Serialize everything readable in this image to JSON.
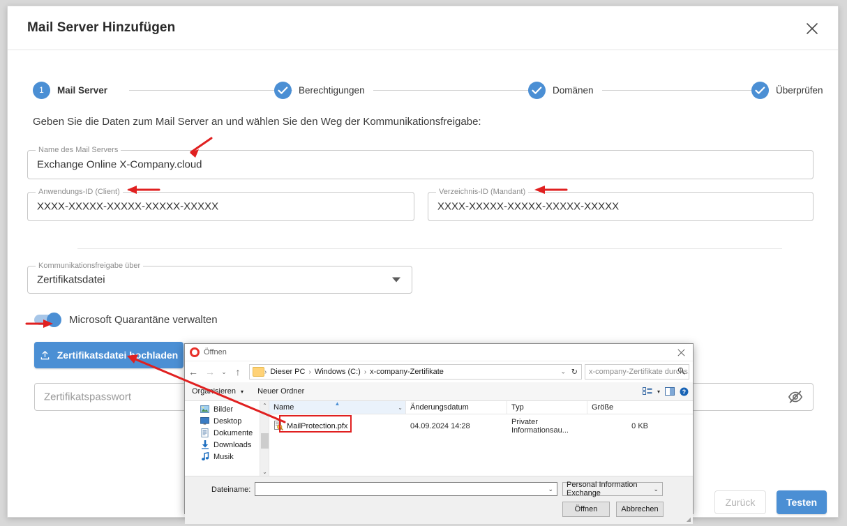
{
  "dialog": {
    "title": "Mail Server Hinzufügen",
    "close_icon": "close-icon"
  },
  "stepper": {
    "steps": [
      {
        "label": "Mail Server",
        "marker": "1",
        "state": "current"
      },
      {
        "label": "Berechtigungen",
        "marker": "check",
        "state": "done"
      },
      {
        "label": "Domänen",
        "marker": "check",
        "state": "done"
      },
      {
        "label": "Überprüfen",
        "marker": "check",
        "state": "done"
      }
    ]
  },
  "form": {
    "intro": "Geben Sie die Daten zum Mail Server an und wählen Sie den Weg der Kommunikationsfreigabe:",
    "server_name": {
      "legend": "Name des Mail Servers",
      "value": "Exchange Online X-Company.cloud"
    },
    "client_id": {
      "legend": "Anwendungs-ID (Client)",
      "value": "XXXX-XXXXX-XXXXX-XXXXX-XXXXX"
    },
    "tenant_id": {
      "legend": "Verzeichnis-ID (Mandant)",
      "value": "XXXX-XXXXX-XXXXX-XXXXX-XXXXX"
    },
    "share_mode": {
      "legend": "Kommunikationsfreigabe über",
      "value": "Zertifikatsdatei"
    },
    "quarantine_toggle": {
      "label": "Microsoft Quarantäne verwalten",
      "state": "on"
    },
    "upload_button": {
      "label": "Zertifikatsdatei hochladen",
      "icon": "upload-icon"
    },
    "cert_password": {
      "placeholder": "Zertifikatspasswort",
      "value": "",
      "toggle_icon": "eye-off-icon"
    }
  },
  "footer": {
    "back_label": "Zurück",
    "test_label": "Testen"
  },
  "file_dialog": {
    "title": "Öffnen",
    "logo_icon": "opera-logo-icon",
    "close_icon": "close-icon",
    "nav": {
      "back_icon": "arrow-left-icon",
      "forward_icon": "arrow-right-icon",
      "recent_icon": "chevron-down-icon",
      "up_icon": "arrow-up-icon"
    },
    "breadcrumb": {
      "folder_icon": "folder-icon",
      "segments": [
        "Dieser PC",
        "Windows (C:)",
        "x-company-Zertifikate"
      ],
      "separator": "›",
      "caret_icon": "chevron-down-icon",
      "refresh_icon": "refresh-icon"
    },
    "search": {
      "placeholder": "x-company-Zertifikate durchs...",
      "icon": "search-icon"
    },
    "toolbar": {
      "organize_label": "Organisieren",
      "organize_caret": "▾",
      "new_folder_label": "Neuer Ordner",
      "view_icon": "view-list-icon",
      "view_caret": "▾",
      "preview_icon": "preview-pane-icon",
      "help_icon": "help-icon"
    },
    "sidebar": [
      {
        "label": "Bilder",
        "icon": "pictures-icon"
      },
      {
        "label": "Desktop",
        "icon": "desktop-icon"
      },
      {
        "label": "Dokumente",
        "icon": "documents-icon"
      },
      {
        "label": "Downloads",
        "icon": "downloads-icon"
      },
      {
        "label": "Musik",
        "icon": "music-icon"
      }
    ],
    "columns": [
      "Name",
      "Änderungsdatum",
      "Typ",
      "Größe"
    ],
    "rows": [
      {
        "name": "MailProtection.pfx",
        "icon": "certificate-file-icon",
        "modified": "04.09.2024 14:28",
        "type": "Privater Informationsau...",
        "size": "0 KB"
      }
    ],
    "filename": {
      "label": "Dateiname:",
      "value": "",
      "caret_icon": "chevron-down-icon"
    },
    "filetype": {
      "value": "Personal Information Exchange",
      "caret_icon": "chevron-down-icon"
    },
    "open_label": "Öffnen",
    "cancel_label": "Abbrechen"
  },
  "colors": {
    "accent": "#4b8fd4",
    "annotation": "#e02020",
    "dialog_bg": "#ffffff",
    "page_bg": "#d8d8d8"
  }
}
